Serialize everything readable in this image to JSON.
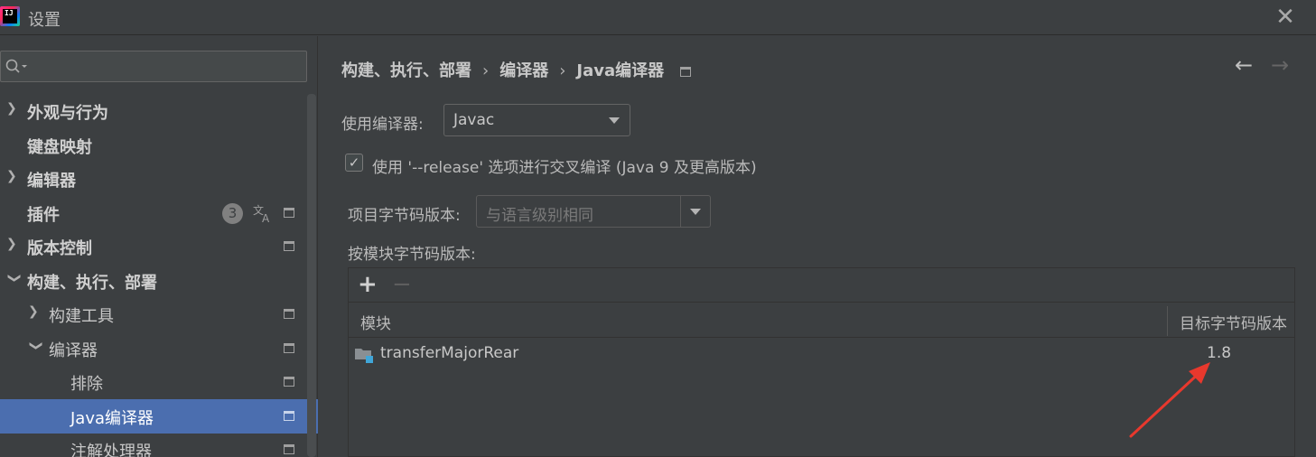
{
  "window": {
    "title": "设置",
    "logo_text": "IJ"
  },
  "sidebar": {
    "search": {
      "placeholder": "",
      "value": ""
    },
    "items": [
      {
        "label": "外观与行为",
        "expandable": true,
        "expanded": false,
        "bold": true
      },
      {
        "label": "键盘映射",
        "expandable": false,
        "bold": true
      },
      {
        "label": "编辑器",
        "expandable": true,
        "expanded": false,
        "bold": true
      },
      {
        "label": "插件",
        "expandable": false,
        "bold": true,
        "badge": "3"
      },
      {
        "label": "版本控制",
        "expandable": true,
        "expanded": false,
        "bold": true
      },
      {
        "label": "构建、执行、部署",
        "expandable": true,
        "expanded": true,
        "bold": true
      },
      {
        "label": "构建工具",
        "expandable": true,
        "expanded": false,
        "bold": false
      },
      {
        "label": "编译器",
        "expandable": true,
        "expanded": true,
        "bold": false
      },
      {
        "label": "排除",
        "expandable": false,
        "bold": false
      },
      {
        "label": "Java编译器",
        "expandable": false,
        "bold": false,
        "selected": true
      },
      {
        "label": "注解处理器",
        "expandable": false,
        "bold": false
      }
    ]
  },
  "main": {
    "breadcrumb": [
      "构建、执行、部署",
      "编译器",
      "Java编译器"
    ],
    "compiler_label": "使用编译器:",
    "compiler_value": "Javac",
    "release_checkbox": {
      "label": "使用 '--release' 选项进行交叉编译 (Java 9 及更高版本)",
      "checked": true
    },
    "project_bytecode_label": "项目字节码版本:",
    "project_bytecode_placeholder": "与语言级别相同",
    "per_module_label": "按模块字节码版本:",
    "table": {
      "columns": [
        "模块",
        "目标字节码版本"
      ],
      "rows": [
        {
          "module": "transferMajorRear",
          "target": "1.8"
        }
      ]
    }
  },
  "colors": {
    "background": "#3c3f41",
    "selection": "#4b6eaf",
    "annotation": "#e8382d"
  }
}
